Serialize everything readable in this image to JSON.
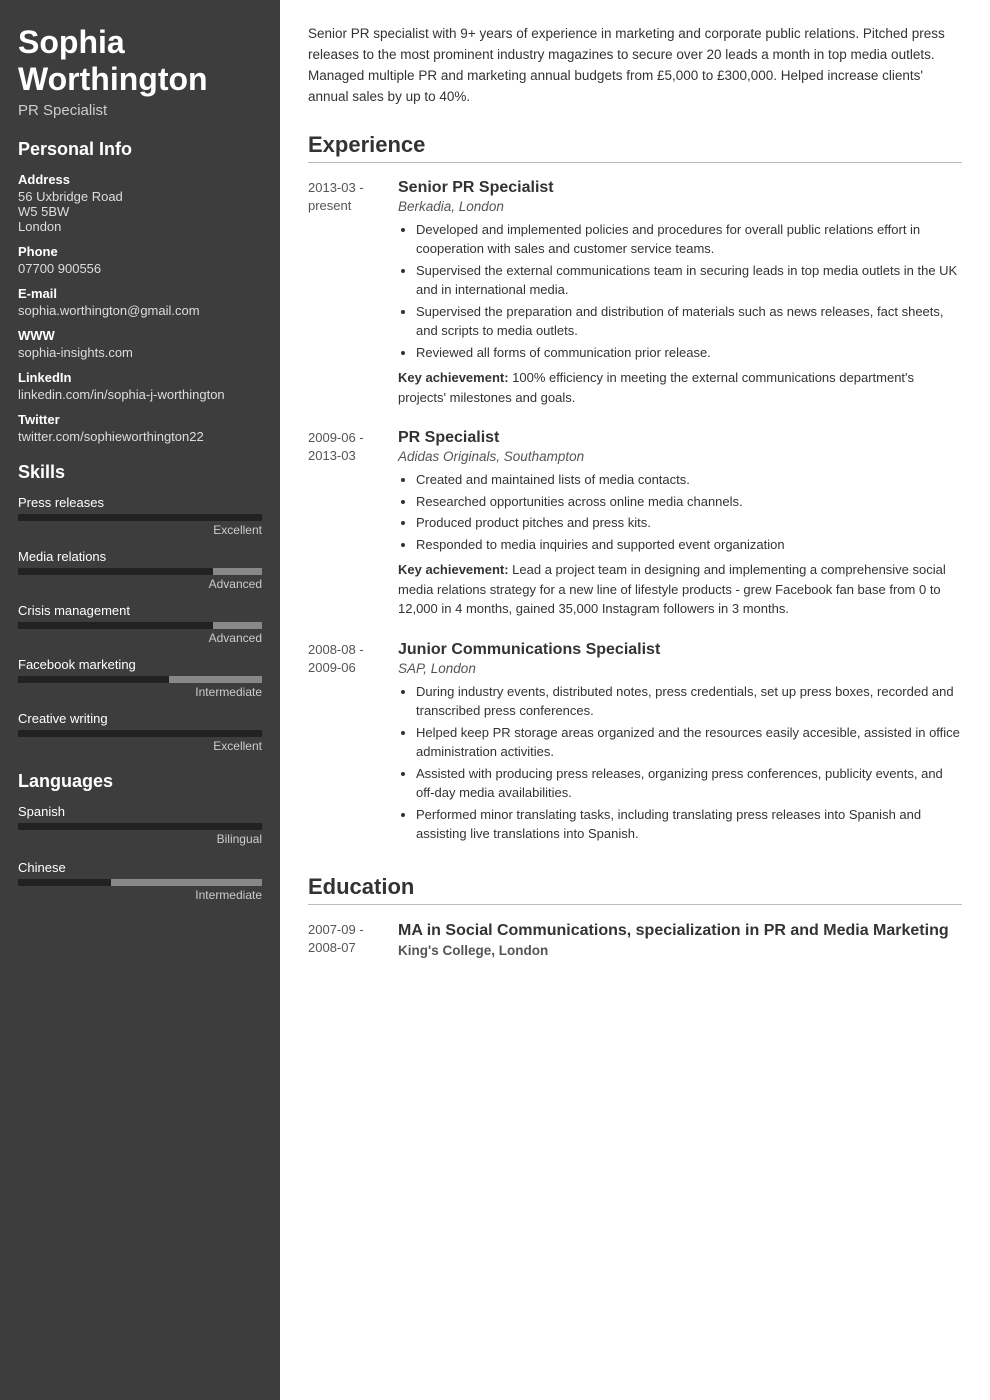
{
  "sidebar": {
    "name": "Sophia Worthington",
    "title": "PR Specialist",
    "sections": {
      "personal_info": {
        "label": "Personal Info",
        "fields": [
          {
            "label": "Address",
            "value": "56 Uxbridge Road\nW5 5BW\nLondon"
          },
          {
            "label": "Phone",
            "value": "07700 900556"
          },
          {
            "label": "E-mail",
            "value": "sophia.worthington@gmail.com"
          },
          {
            "label": "WWW",
            "value": "sophia-insights.com"
          },
          {
            "label": "LinkedIn",
            "value": "linkedin.com/in/sophia-j-worthington"
          },
          {
            "label": "Twitter",
            "value": "twitter.com/sophieworthington22"
          }
        ]
      },
      "skills": {
        "label": "Skills",
        "items": [
          {
            "name": "Press releases",
            "level": "Excellent",
            "pct": 100
          },
          {
            "name": "Media relations",
            "level": "Advanced",
            "pct": 80
          },
          {
            "name": "Crisis management",
            "level": "Advanced",
            "pct": 80
          },
          {
            "name": "Facebook marketing",
            "level": "Intermediate",
            "pct": 60
          },
          {
            "name": "Creative writing",
            "level": "Excellent",
            "pct": 100
          }
        ]
      },
      "languages": {
        "label": "Languages",
        "items": [
          {
            "name": "Spanish",
            "level": "Bilingual",
            "pct": 100
          },
          {
            "name": "Chinese",
            "level": "Intermediate",
            "pct": 40
          }
        ]
      }
    }
  },
  "main": {
    "summary": "Senior PR specialist with 9+ years of experience in marketing and corporate public relations. Pitched press releases to the most prominent industry magazines to secure over 20 leads a month in top media outlets. Managed multiple PR and marketing annual budgets from £5,000 to £300,000. Helped increase clients' annual sales by up to 40%.",
    "experience": {
      "label": "Experience",
      "items": [
        {
          "date": "2013-03 - present",
          "title": "Senior PR Specialist",
          "company": "Berkadia, London",
          "bullets": [
            "Developed and implemented policies and procedures for overall public relations effort in cooperation with sales and customer service teams.",
            "Supervised the external communications team in securing leads in top media outlets in the UK and in international media.",
            "Supervised the preparation and distribution of materials such as news releases, fact sheets, and scripts to media outlets.",
            "Reviewed all forms of communication prior release."
          ],
          "achievement": "Key achievement: 100% efficiency in meeting the external communications department's projects' milestones and goals."
        },
        {
          "date": "2009-06 - 2013-03",
          "title": "PR Specialist",
          "company": "Adidas Originals, Southampton",
          "bullets": [
            "Created and maintained lists of media contacts.",
            "Researched opportunities across online media channels.",
            "Produced product pitches and press kits.",
            "Responded to media inquiries and supported event organization"
          ],
          "achievement": "Key achievement: Lead a project team in designing and implementing a comprehensive social media relations strategy for a new line of lifestyle products - grew Facebook fan base from 0 to 12,000 in 4 months, gained 35,000 Instagram followers in 3 months."
        },
        {
          "date": "2008-08 - 2009-06",
          "title": "Junior Communications Specialist",
          "company": "SAP, London",
          "bullets": [
            "During industry events, distributed notes, press credentials, set up press boxes, recorded and transcribed press conferences.",
            "Helped keep PR storage areas organized and the resources easily accesible, assisted in office administration activities.",
            "Assisted with producing press releases, organizing press conferences, publicity events, and off-day media availabilities.",
            "Performed minor translating tasks, including translating press releases into Spanish and assisting live translations into Spanish."
          ],
          "achievement": ""
        }
      ]
    },
    "education": {
      "label": "Education",
      "items": [
        {
          "date": "2007-09 - 2008-07",
          "degree": "MA in Social Communications, specialization in PR and Media Marketing",
          "school": "King's College, London"
        }
      ]
    }
  }
}
